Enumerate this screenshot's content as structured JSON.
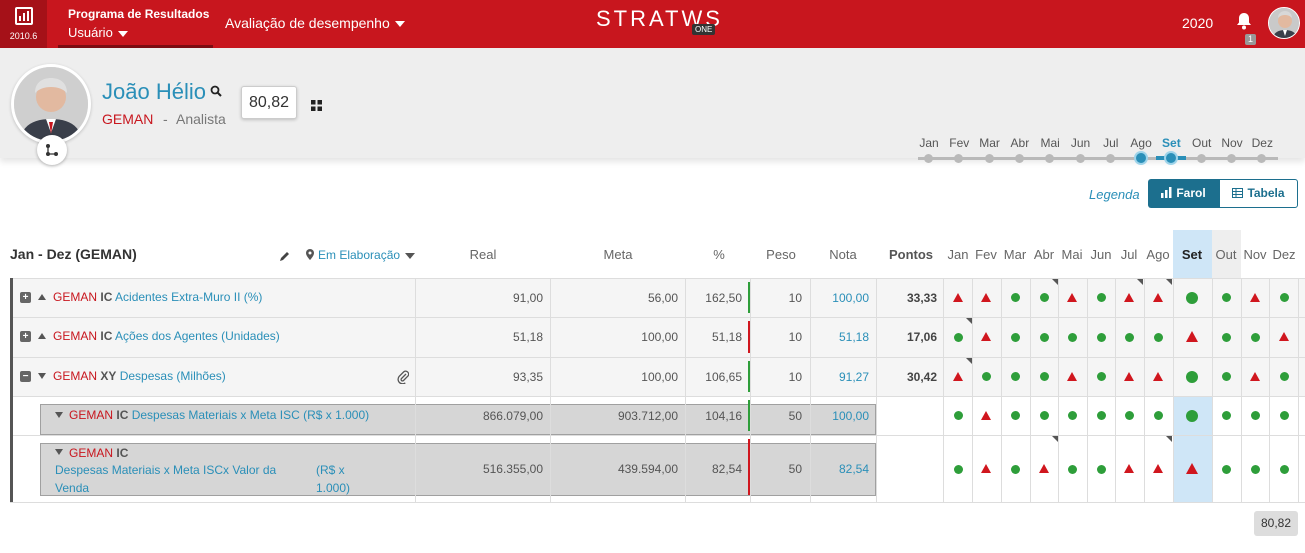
{
  "app": {
    "version": "2010.6",
    "program_title": "Programa de Resultados",
    "program_sub": "Usuário",
    "menu_label": "Avaliação de desempenho",
    "logo": "STRATWS",
    "logo_badge": "ONE",
    "year": "2020",
    "notif_count": "1",
    "brand_color": "#c8161e"
  },
  "profile": {
    "name": "João Hélio",
    "dept": "GEMAN",
    "sep": "-",
    "role": "Analista",
    "score": "80,82"
  },
  "timeline": {
    "months": [
      "Jan",
      "Fev",
      "Mar",
      "Abr",
      "Mai",
      "Jun",
      "Jul",
      "Ago",
      "Set",
      "Out",
      "Nov",
      "Dez"
    ],
    "selected_range": [
      "Ago",
      "Set"
    ],
    "active_label": "Set"
  },
  "controls": {
    "legend": "Legenda",
    "farol": "Farol",
    "tabela": "Tabela"
  },
  "table": {
    "period": "Jan - Dez (GEMAN)",
    "status": "Em Elaboração",
    "headers": {
      "real": "Real",
      "meta": "Meta",
      "pct": "%",
      "peso": "Peso",
      "nota": "Nota",
      "pontos": "Pontos"
    },
    "months": [
      "Jan",
      "Fev",
      "Mar",
      "Abr",
      "Mai",
      "Jun",
      "Jul",
      "Ago",
      "Set",
      "Out",
      "Nov",
      "Dez"
    ],
    "rows": [
      {
        "dept": "GEMAN",
        "type": "IC",
        "name": "Acidentes Extra-Muro II (%)",
        "real": "91,00",
        "meta": "56,00",
        "pct": "162,50",
        "bar": "g",
        "peso": "10",
        "nota": "100,00",
        "pontos": "33,33",
        "marks": [
          "r",
          "r",
          "g",
          "g",
          "r",
          "g",
          "r",
          "r",
          "g",
          "g",
          "r",
          "g"
        ],
        "corners": [
          3,
          6,
          7
        ]
      },
      {
        "dept": "GEMAN",
        "type": "IC",
        "name": "Ações dos Agentes (Unidades)",
        "real": "51,18",
        "meta": "100,00",
        "pct": "51,18",
        "bar": "r",
        "peso": "10",
        "nota": "51,18",
        "pontos": "17,06",
        "marks": [
          "g",
          "r",
          "g",
          "g",
          "g",
          "g",
          "g",
          "g",
          "r",
          "g",
          "g",
          "r"
        ],
        "corners": [
          0
        ]
      },
      {
        "dept": "GEMAN",
        "type": "XY",
        "name": "Despesas (Milhões)",
        "real": "93,35",
        "meta": "100,00",
        "pct": "106,65",
        "bar": "g",
        "peso": "10",
        "nota": "91,27",
        "pontos": "30,42",
        "marks": [
          "r",
          "g",
          "g",
          "g",
          "r",
          "g",
          "r",
          "r",
          "g",
          "g",
          "r",
          "g"
        ],
        "corners": [
          0
        ]
      },
      {
        "dept": "GEMAN",
        "type": "IC",
        "name": "Despesas Materiais x Meta ISC (R$ x 1.000)",
        "real": "866.079,00",
        "meta": "903.712,00",
        "pct": "104,16",
        "bar": "g",
        "peso": "50",
        "nota": "100,00",
        "pontos": "",
        "marks": [
          "g",
          "r",
          "g",
          "g",
          "g",
          "g",
          "g",
          "g",
          "g",
          "g",
          "g",
          "g"
        ],
        "corners": []
      },
      {
        "dept": "GEMAN",
        "type": "IC",
        "name_line1": "Despesas Materiais x Meta ISCx Valor da",
        "name_line2": "Venda",
        "unit_line1": "(R$ x",
        "unit_line2": "1.000)",
        "real": "516.355,00",
        "meta": "439.594,00",
        "pct": "82,54",
        "bar": "r",
        "peso": "50",
        "nota": "82,54",
        "pontos": "",
        "marks": [
          "g",
          "r",
          "g",
          "r",
          "g",
          "g",
          "r",
          "r",
          "r",
          "g",
          "g",
          "g"
        ],
        "corners": [
          3,
          7
        ]
      }
    ],
    "total": "80,82"
  }
}
